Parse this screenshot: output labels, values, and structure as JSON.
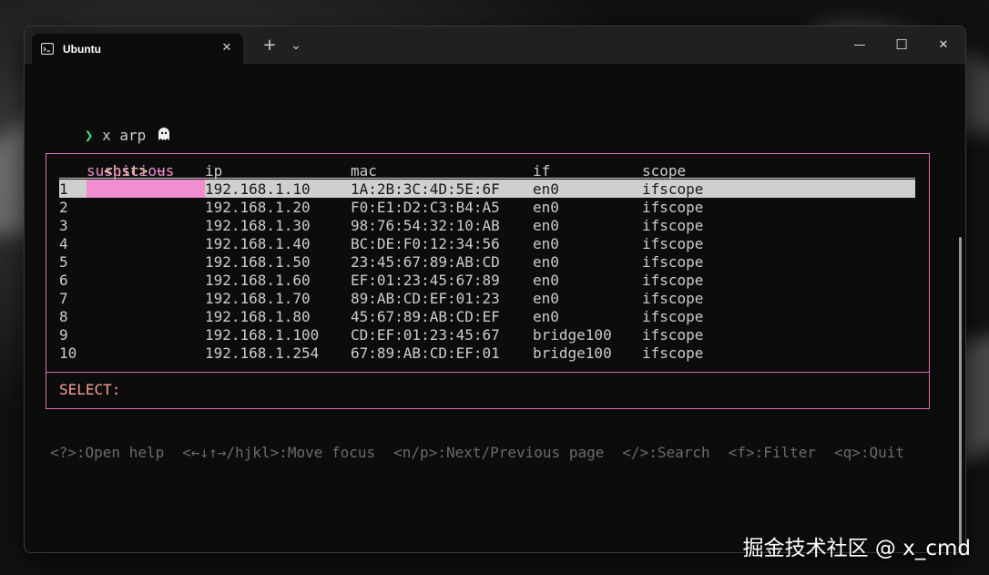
{
  "window": {
    "tab_title": "Ubuntu",
    "tab_icon": "terminal-icon",
    "tab_close": "✕",
    "new_tab": "+",
    "dropdown": "⌄",
    "minimize": "—",
    "maximize": "☐",
    "close": "✕"
  },
  "prompt": {
    "ghost_icon": "ghost-icon",
    "host": "<hst>",
    "path": "~",
    "chevron": "❯",
    "command": "x arp"
  },
  "table": {
    "columns": [
      "",
      "suspicious",
      "ip",
      "mac",
      "if",
      "scope"
    ],
    "rows": [
      {
        "n": "1",
        "suspicious": "",
        "ip": "192.168.1.10",
        "mac": "1A:2B:3C:4D:5E:6F",
        "if": "en0",
        "scope": "ifscope"
      },
      {
        "n": "2",
        "suspicious": "",
        "ip": "192.168.1.20",
        "mac": "F0:E1:D2:C3:B4:A5",
        "if": "en0",
        "scope": "ifscope"
      },
      {
        "n": "3",
        "suspicious": "",
        "ip": "192.168.1.30",
        "mac": "98:76:54:32:10:AB",
        "if": "en0",
        "scope": "ifscope"
      },
      {
        "n": "4",
        "suspicious": "",
        "ip": "192.168.1.40",
        "mac": "BC:DE:F0:12:34:56",
        "if": "en0",
        "scope": "ifscope"
      },
      {
        "n": "5",
        "suspicious": "",
        "ip": "192.168.1.50",
        "mac": "23:45:67:89:AB:CD",
        "if": "en0",
        "scope": "ifscope"
      },
      {
        "n": "6",
        "suspicious": "",
        "ip": "192.168.1.60",
        "mac": "EF:01:23:45:67:89",
        "if": "en0",
        "scope": "ifscope"
      },
      {
        "n": "7",
        "suspicious": "",
        "ip": "192.168.1.70",
        "mac": "89:AB:CD:EF:01:23",
        "if": "en0",
        "scope": "ifscope"
      },
      {
        "n": "8",
        "suspicious": "",
        "ip": "192.168.1.80",
        "mac": "45:67:89:AB:CD:EF",
        "if": "en0",
        "scope": "ifscope"
      },
      {
        "n": "9",
        "suspicious": "",
        "ip": "192.168.1.100",
        "mac": "CD:EF:01:23:45:67",
        "if": "bridge100",
        "scope": "ifscope"
      },
      {
        "n": "10",
        "suspicious": "",
        "ip": "192.168.1.254",
        "mac": "67:89:AB:CD:EF:01",
        "if": "bridge100",
        "scope": "ifscope"
      }
    ],
    "select_label": "SELECT:"
  },
  "help": [
    "<?>:Open help",
    "<←↓↑→/hjkl>:Move focus",
    "<n/p>:Next/Previous page",
    "</>:Search",
    "<f>:Filter",
    "<q>:Quit"
  ],
  "watermark": "掘金技术社区 @ x_cmd",
  "colors": {
    "accent_pink": "#f08ecf",
    "border_pink": "#e06fb6",
    "prompt_yellow": "#f0e6a0",
    "chevron_green": "#3ddc84",
    "selected_row": "#cfcfcf"
  }
}
